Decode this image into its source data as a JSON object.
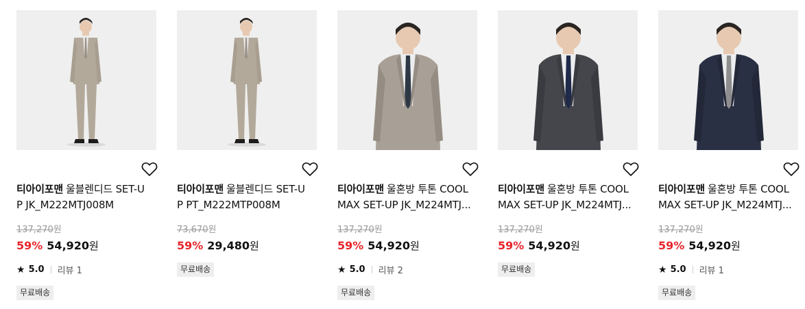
{
  "products": [
    {
      "brand": "티아이포맨",
      "name_line1": "울블렌디드 SET-U",
      "name_line2": "P JK_M222MTJ008M",
      "original_price": "137,270",
      "currency": "원",
      "discount": "59%",
      "price": "54,920",
      "rating": "5.0",
      "review": "리뷰 1",
      "badge": "무료배송",
      "image": {
        "type": "full-body",
        "suit": "#b3a99b",
        "tie": "#9a9086"
      }
    },
    {
      "brand": "티아이포맨",
      "name_line1": "울블렌디드 SET-U",
      "name_line2": "P PT_M222MTP008M",
      "original_price": "73,670",
      "currency": "원",
      "discount": "59%",
      "price": "29,480",
      "rating": null,
      "review": null,
      "badge": "무료배송",
      "image": {
        "type": "full-body",
        "suit": "#b3a99b",
        "tie": "#9a9086"
      }
    },
    {
      "brand": "티아이포맨",
      "name_line1": "울혼방 투톤 COOL",
      "name_line2": "MAX SET-UP JK_M224MTJ...",
      "original_price": "137,270",
      "currency": "원",
      "discount": "59%",
      "price": "54,920",
      "rating": "5.0",
      "review": "리뷰 2",
      "badge": "무료배송",
      "image": {
        "type": "half-body",
        "suit": "#a8a096",
        "tie": "#2e3845"
      }
    },
    {
      "brand": "티아이포맨",
      "name_line1": "울혼방 투톤 COOL",
      "name_line2": "MAX SET-UP JK_M224MTJ...",
      "original_price": "137,270",
      "currency": "원",
      "discount": "59%",
      "price": "54,920",
      "rating": null,
      "review": null,
      "badge": "무료배송",
      "image": {
        "type": "half-body",
        "suit": "#45464b",
        "tie": "#1f2a4a"
      }
    },
    {
      "brand": "티아이포맨",
      "name_line1": "울혼방 투톤 COOL",
      "name_line2": "MAX SET-UP JK_M224MTJ...",
      "original_price": "137,270",
      "currency": "원",
      "discount": "59%",
      "price": "54,920",
      "rating": "5.0",
      "review": "리뷰 1",
      "badge": "무료배송",
      "image": {
        "type": "half-body",
        "suit": "#2a3044",
        "tie": "#8e8e8e"
      }
    }
  ],
  "colors": {
    "discount": "#e8242a",
    "strike": "#9a9a9a",
    "badge_bg": "#eeeeee",
    "thumb_bg": "#efefef"
  },
  "icons": {
    "wish": "heart-outline-icon",
    "star": "star-filled-icon"
  }
}
